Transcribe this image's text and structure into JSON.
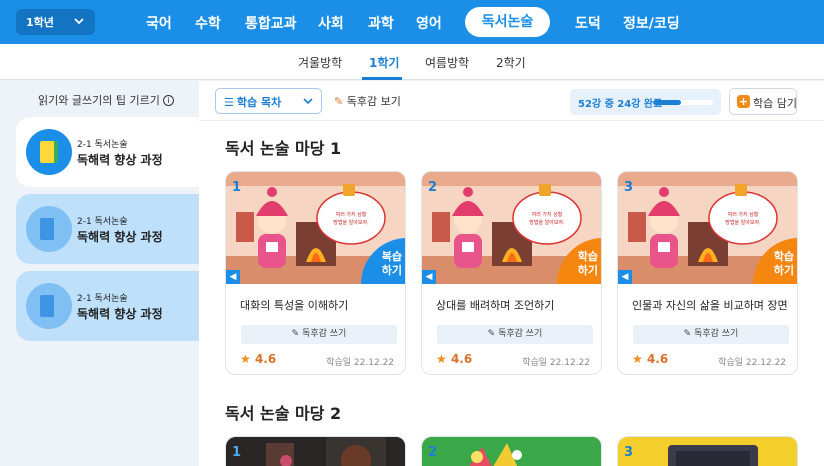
{
  "header": {
    "grade": "1학년",
    "subjects": [
      "국어",
      "수학",
      "통합교과",
      "사회",
      "과학",
      "영어"
    ],
    "active_subject": "독서논술",
    "subjects_right": [
      "도덕",
      "정보/코딩"
    ]
  },
  "terms": {
    "items": [
      "겨울방학",
      "1학기",
      "여름방학",
      "2학기"
    ],
    "active": "1학기"
  },
  "sidebar": {
    "tip": "읽기와 글쓰기의 팁 기르기",
    "courses": [
      {
        "sub": "2-1 독서논술",
        "title": "독해력 향상 과정"
      },
      {
        "sub": "2-1 독서논술",
        "title": "독해력 향상 과정"
      },
      {
        "sub": "2-1 독서논술",
        "title": "독해력 향상 과정"
      }
    ]
  },
  "toolbar": {
    "toc_label": "학습 목차",
    "review_label": "독후감 보기",
    "progress_text": "52강 중 24강 완료",
    "progress_fraction": 0.4615,
    "save_label": "학습 담기"
  },
  "sections": [
    {
      "title": "독서 논술 마당 1",
      "cards": [
        {
          "num": "1",
          "title": "대화의 특성을 이해하기",
          "badge": "복습\n하기",
          "badge_color": "#1b8fe8",
          "write_label": "독후감 쓰기",
          "rating": "4.6",
          "date": "학습일 22.12.22",
          "thumb_text": "여러 가지 상황\n방법을 알아보자."
        },
        {
          "num": "2",
          "title": "상대를 배려하며 조언하기",
          "badge": "학습\n하기",
          "badge_color": "#f5860f",
          "write_label": "독후감 쓰기",
          "rating": "4.6",
          "date": "학습일 22.12.22",
          "thumb_text": "여러 가지 상황\n방법을 알아보자."
        },
        {
          "num": "3",
          "title": "인물과 자신의 삶을 비교하며 장면",
          "badge": "학습\n하기",
          "badge_color": "#f5860f",
          "write_label": "독후감 쓰기",
          "rating": "4.6",
          "date": "학습일 22.12.22",
          "thumb_text": "여러 가지 상황\n방법을 알아보자."
        }
      ]
    },
    {
      "title": "독서 논술 마당 2",
      "cards": [
        {
          "num": "1"
        },
        {
          "num": "2"
        },
        {
          "num": "3"
        }
      ]
    }
  ],
  "colors": {
    "primary": "#1b8fe8",
    "accent_orange": "#f5860f"
  }
}
